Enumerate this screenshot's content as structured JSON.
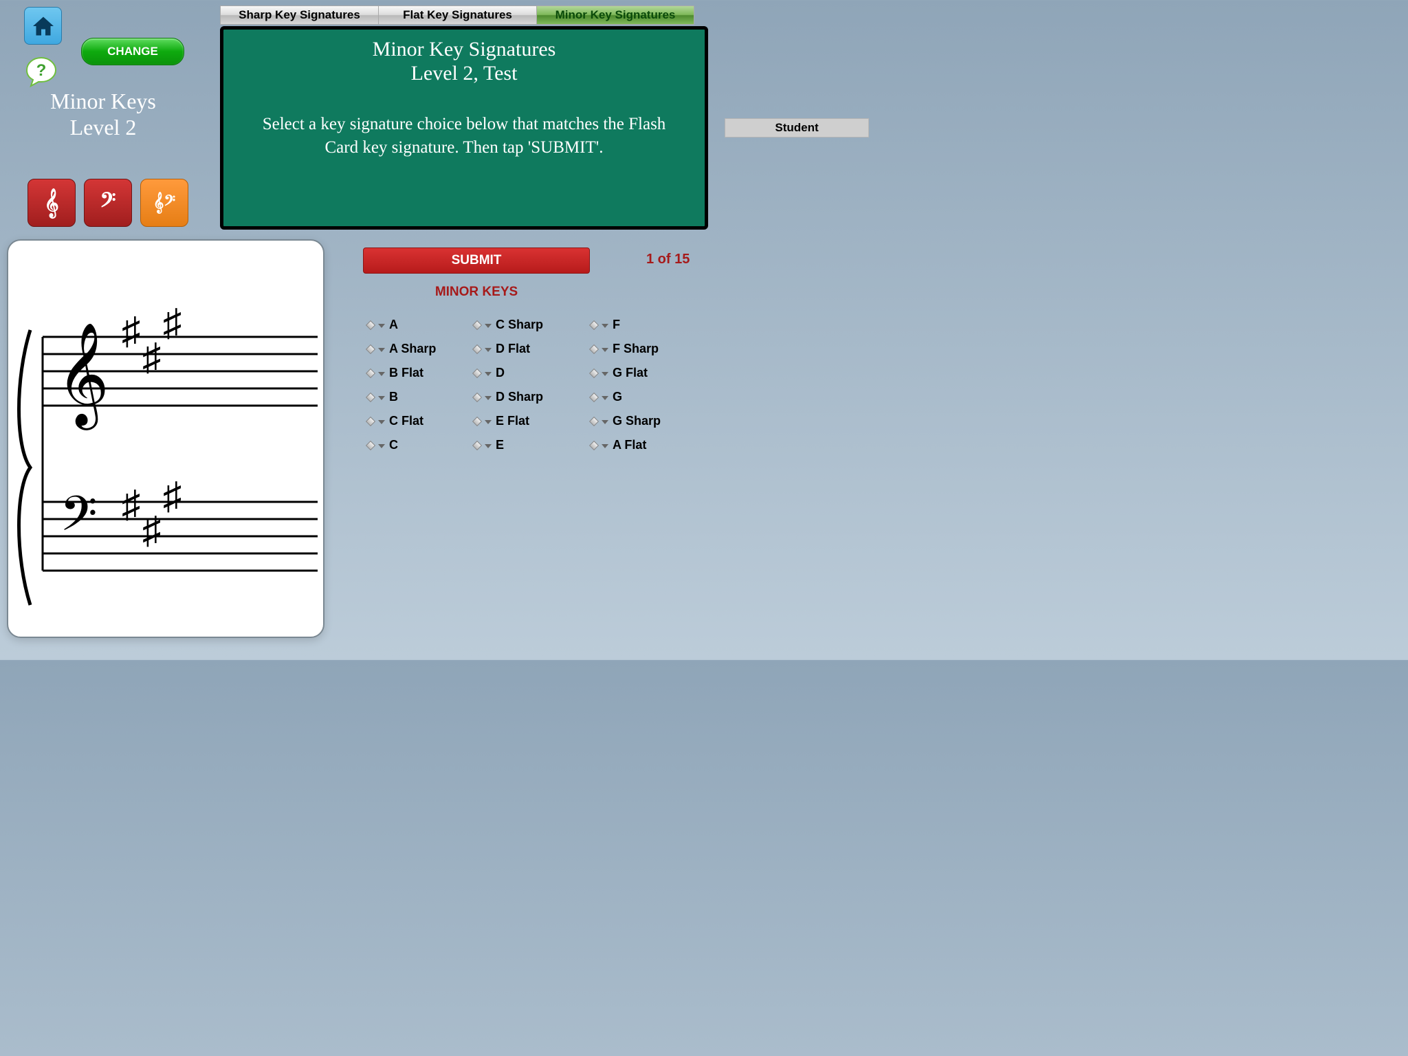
{
  "header": {
    "change_label": "CHANGE",
    "left_title_line1": "Minor Keys",
    "left_title_line2": "Level 2"
  },
  "tabs": {
    "t1": "Sharp Key Signatures",
    "t2": "Flat Key Signatures",
    "t3": "Minor Key Signatures"
  },
  "board": {
    "title_line1": "Minor Key Signatures",
    "title_line2": "Level 2, Test",
    "instructions": "Select a key signature choice below that matches the Flash Card key signature. Then tap 'SUBMIT'."
  },
  "student_label": "Student",
  "submit_label": "SUBMIT",
  "progress": "1 of 15",
  "section_title": "MINOR KEYS",
  "keys": {
    "col1": [
      "A",
      "A Sharp",
      "B Flat",
      "B",
      "C Flat",
      "C"
    ],
    "col2": [
      "C Sharp",
      "D Flat",
      "D",
      "D Sharp",
      "E Flat",
      "E"
    ],
    "col3": [
      "F",
      "F Sharp",
      "G Flat",
      "G",
      "G Sharp",
      "A Flat"
    ]
  },
  "clef_icons": {
    "treble": "𝄞",
    "bass": "𝄢",
    "both": "𝄞𝄢"
  }
}
